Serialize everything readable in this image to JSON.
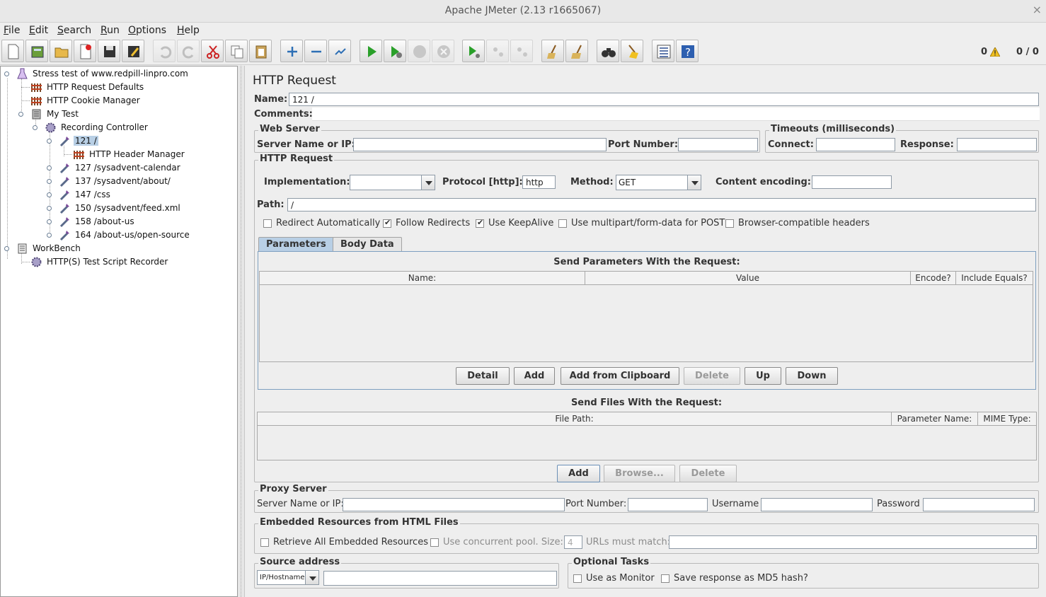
{
  "window": {
    "title": "Apache JMeter (2.13 r1665067)",
    "close_glyph": "×"
  },
  "menu": [
    {
      "label": "File",
      "mnemonic": "F",
      "rest": "ile"
    },
    {
      "label": "Edit",
      "mnemonic": "E",
      "rest": "dit"
    },
    {
      "label": "Search",
      "mnemonic": "S",
      "rest": "earch"
    },
    {
      "label": "Run",
      "mnemonic": "R",
      "rest": "un"
    },
    {
      "label": "Options",
      "mnemonic": "O",
      "rest": "ptions"
    },
    {
      "label": "Help",
      "mnemonic": "H",
      "rest": "elp"
    }
  ],
  "toolbar": {
    "warnings": "0",
    "threads": "0 / 0"
  },
  "tree": [
    {
      "label": "Stress test of www.redpill-linpro.com",
      "icon": "test-plan-icon"
    },
    {
      "label": "HTTP Request Defaults",
      "icon": "config-element-icon"
    },
    {
      "label": "HTTP Cookie Manager",
      "icon": "config-element-icon"
    },
    {
      "label": "My Test",
      "icon": "thread-group-icon"
    },
    {
      "label": "Recording Controller",
      "icon": "controller-icon"
    },
    {
      "label": "121 /",
      "icon": "sampler-icon",
      "selected": true
    },
    {
      "label": "HTTP Header Manager",
      "icon": "config-element-icon"
    },
    {
      "label": "127 /sysadvent-calendar",
      "icon": "sampler-icon"
    },
    {
      "label": "137 /sysadvent/about/",
      "icon": "sampler-icon"
    },
    {
      "label": "147 /css",
      "icon": "sampler-icon"
    },
    {
      "label": "150 /sysadvent/feed.xml",
      "icon": "sampler-icon"
    },
    {
      "label": "158 /about-us",
      "icon": "sampler-icon"
    },
    {
      "label": "164 /about-us/open-source",
      "icon": "sampler-icon"
    },
    {
      "label": "WorkBench",
      "icon": "workbench-icon"
    },
    {
      "label": "HTTP(S) Test Script Recorder",
      "icon": "controller-icon"
    }
  ],
  "form": {
    "heading": "HTTP Request",
    "name_label": "Name:",
    "name_value": "121 /",
    "comments_label": "Comments:",
    "web_server": {
      "title": "Web Server",
      "server_label": "Server Name or IP:",
      "server_value": "",
      "port_label": "Port Number:",
      "port_value": ""
    },
    "timeouts": {
      "title": "Timeouts (milliseconds)",
      "connect_label": "Connect:",
      "connect_value": "",
      "response_label": "Response:",
      "response_value": ""
    },
    "http_request": {
      "title": "HTTP Request",
      "implementation_label": "Implementation:",
      "implementation_value": "",
      "protocol_label": "Protocol [http]:",
      "protocol_value": "http",
      "method_label": "Method:",
      "method_value": "GET",
      "encoding_label": "Content encoding:",
      "encoding_value": "",
      "path_label": "Path:",
      "path_value": "/",
      "checkboxes": [
        {
          "label": "Redirect Automatically",
          "checked": false
        },
        {
          "label": "Follow Redirects",
          "checked": true
        },
        {
          "label": "Use KeepAlive",
          "checked": true
        },
        {
          "label": "Use multipart/form-data for POST",
          "checked": false
        },
        {
          "label": "Browser-compatible headers",
          "checked": false
        }
      ]
    },
    "tabs": [
      {
        "label": "Parameters",
        "active": true
      },
      {
        "label": "Body Data",
        "active": false
      }
    ],
    "params": {
      "title": "Send Parameters With the Request:",
      "columns": [
        "Name:",
        "Value",
        "Encode?",
        "Include Equals?"
      ],
      "buttons": [
        "Detail",
        "Add",
        "Add from Clipboard",
        "Delete",
        "Up",
        "Down"
      ]
    },
    "files": {
      "title": "Send Files With the Request:",
      "columns": [
        "File Path:",
        "Parameter Name:",
        "MIME Type:"
      ],
      "buttons": [
        "Add",
        "Browse...",
        "Delete"
      ]
    },
    "proxy": {
      "title": "Proxy Server",
      "server_label": "Server Name or IP:",
      "server_value": "",
      "port_label": "Port Number:",
      "port_value": "",
      "username_label": "Username",
      "username_value": "",
      "password_label": "Password",
      "password_value": ""
    },
    "embedded": {
      "title": "Embedded Resources from HTML Files",
      "retrieve_label": "Retrieve All Embedded Resources",
      "pool_label": "Use concurrent pool. Size:",
      "pool_size": "4",
      "urls_label": "URLs must match:",
      "urls_value": ""
    },
    "source": {
      "title": "Source address",
      "type_value": "IP/Hostname",
      "address_value": ""
    },
    "optional": {
      "title": "Optional Tasks",
      "monitor_label": "Use as Monitor",
      "md5_label": "Save response as MD5 hash?"
    }
  }
}
